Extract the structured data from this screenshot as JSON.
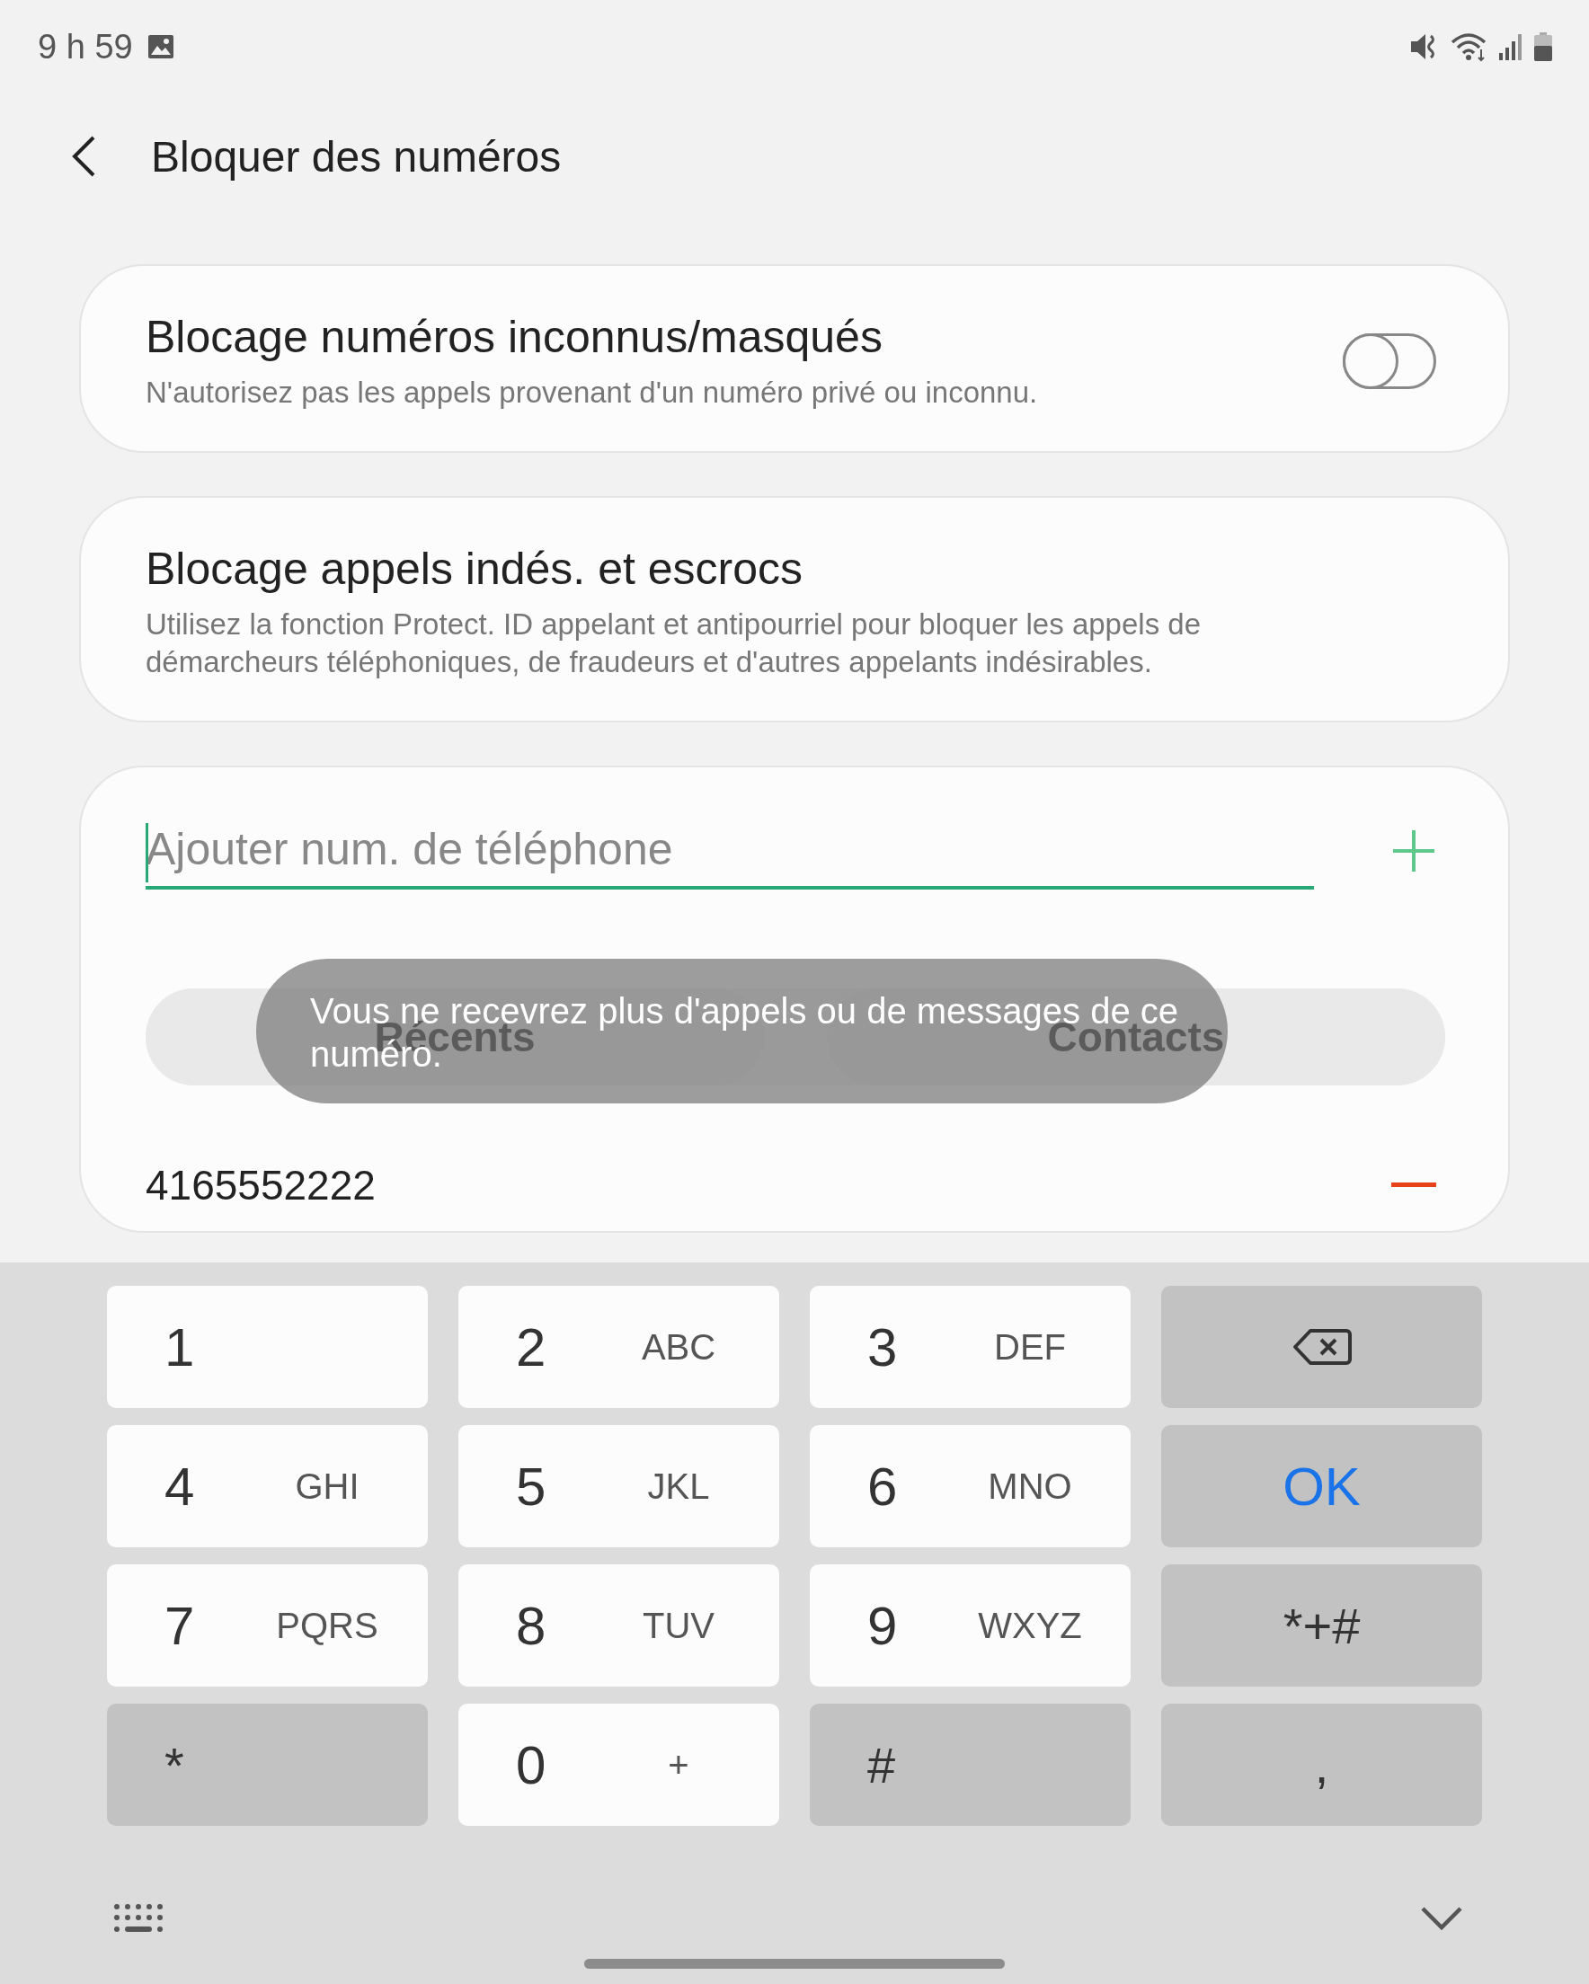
{
  "status_bar": {
    "time": "9 h 59"
  },
  "header": {
    "title": "Bloquer des numéros"
  },
  "settings": [
    {
      "title": "Blocage numéros inconnus/masqués",
      "subtitle": "N'autorisez pas les appels provenant d'un numéro privé ou inconnu.",
      "kind": "toggle",
      "on": false
    },
    {
      "title": "Blocage appels indés. et escrocs",
      "subtitle": "Utilisez la fonction Protect. ID appelant et antipourriel pour bloquer les appels de démarcheurs téléphoniques, de fraudeurs et d'autres appelants indésirables.",
      "kind": "plain"
    }
  ],
  "add_number": {
    "placeholder": "Ajouter num. de téléphone"
  },
  "tabs": [
    {
      "label": "Récents",
      "selected": false
    },
    {
      "label": "Contacts",
      "selected": false
    }
  ],
  "toast": "Vous ne recevrez plus d'appels ou de messages de ce numéro.",
  "blocked_numbers": [
    "4165552222"
  ],
  "keypad": [
    {
      "kind": "digit",
      "label": "1"
    },
    {
      "kind": "digit",
      "label": "2",
      "letters": "ABC"
    },
    {
      "kind": "digit",
      "label": "3",
      "letters": "DEF"
    },
    {
      "kind": "backspace"
    },
    {
      "kind": "digit",
      "label": "4",
      "letters": "GHI"
    },
    {
      "kind": "digit",
      "label": "5",
      "letters": "JKL"
    },
    {
      "kind": "digit",
      "label": "6",
      "letters": "MNO"
    },
    {
      "kind": "ok",
      "label": "OK"
    },
    {
      "kind": "digit",
      "label": "7",
      "letters": "PQRS"
    },
    {
      "kind": "digit",
      "label": "8",
      "letters": "TUV"
    },
    {
      "kind": "digit",
      "label": "9",
      "letters": "WXYZ"
    },
    {
      "kind": "function",
      "label": "*+#"
    },
    {
      "kind": "function",
      "label": "*"
    },
    {
      "kind": "digit",
      "label": "0",
      "letters": "+"
    },
    {
      "kind": "function",
      "label": "#"
    },
    {
      "kind": "function",
      "label": ","
    }
  ]
}
